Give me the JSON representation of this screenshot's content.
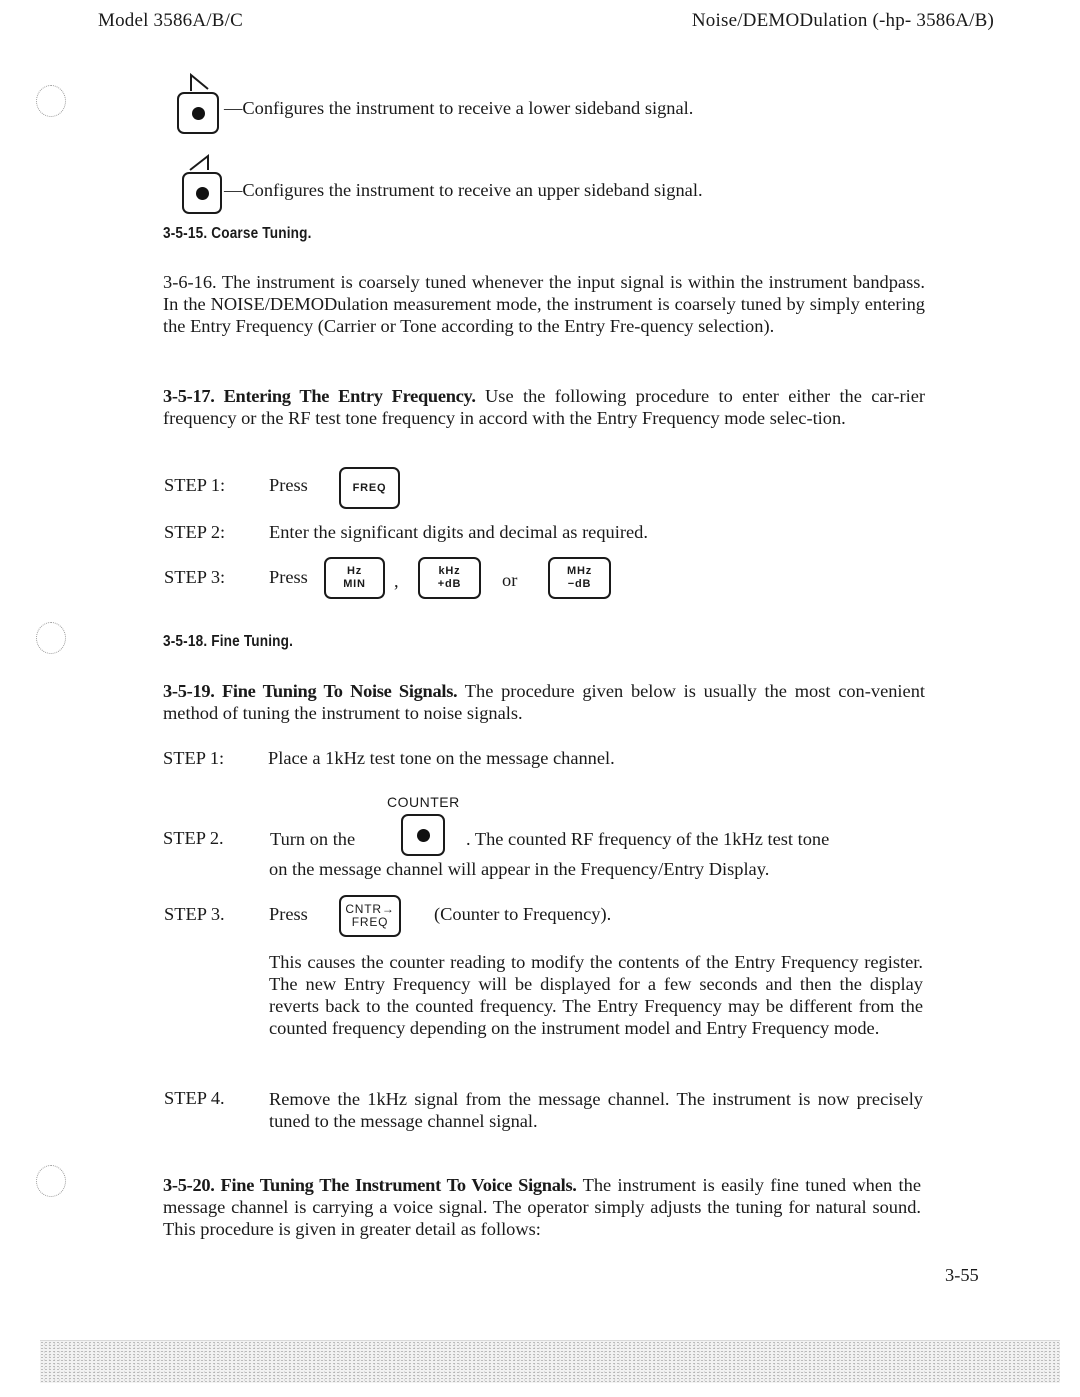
{
  "header": {
    "left": "Model 3586A/B/C",
    "right": "Noise/DEMODulation (-hp- 3586A/B)"
  },
  "sideband": {
    "lower": {
      "icon": "lower-sideband-arrow-icon",
      "text": "—Configures the instrument to receive a lower sideband signal."
    },
    "upper": {
      "icon": "upper-sideband-arrow-icon",
      "text": "—Configures the instrument to receive an upper sideband signal."
    }
  },
  "sections": {
    "coarse_heading": "3-5-15. Coarse Tuning.",
    "coarse_para": "3-6-16. The instrument is coarsely tuned whenever the input signal is within the instrument bandpass. In the NOISE/DEMODulation measurement mode, the instrument is coarsely tuned by simply entering the Entry Frequency (Carrier or Tone according to the Entry Fre-quency selection).",
    "entering_bold": "3-5-17. Entering The Entry Frequency.",
    "entering_text": " Use the following procedure to enter either the car-rier frequency or the RF test tone frequency in accord with the Entry Frequency mode selec-tion.",
    "fine_heading": "3-5-18. Fine Tuning.",
    "fine_noise_bold": "3-5-19. Fine Tuning To Noise Signals.",
    "fine_noise_text": " The procedure given below is usually the most con-venient method of tuning the instrument to noise signals.",
    "voice_bold": "3-5-20. Fine Tuning The Instrument To Voice Signals.",
    "voice_text": " The instrument is easily fine tuned when the message channel is carrying a voice signal. The operator simply adjusts the tuning for natural sound. This procedure is given in greater detail as follows:"
  },
  "entry_steps": {
    "s1_label": "STEP 1:",
    "s1_press": "Press",
    "key_freq": "FREQ",
    "s2_label": "STEP 2:",
    "s2_text": "Enter the significant digits and decimal as required.",
    "s3_label": "STEP 3:",
    "s3_press": "Press",
    "key_hz_top": "Hz",
    "key_hz_bottom": "MIN",
    "comma": ",",
    "key_khz_top": "kHz",
    "key_khz_bottom": "+dB",
    "or": "or",
    "key_mhz_top": "MHz",
    "key_mhz_bottom": "−dB"
  },
  "noise_steps": {
    "s1_label": "STEP 1:",
    "s1_text": "Place a 1kHz test tone on the message channel.",
    "counter_label": "COUNTER",
    "s2_label": "STEP 2.",
    "s2_text_a": "Turn on the",
    "s2_text_b": ". The counted RF frequency of the 1kHz test tone",
    "s2_text_c": "on the message channel will appear in the Frequency/Entry Display.",
    "s3_label": "STEP 3.",
    "s3_press": "Press",
    "key_cntr_top": "CNTR→",
    "key_cntr_bottom": "FREQ",
    "s3_after": "(Counter to Frequency).",
    "s3_para": "This causes the counter reading to modify the contents of the Entry Frequency register. The new Entry Frequency will be displayed for a few seconds and then the display reverts back to the counted frequency. The Entry Frequency may be different from the counted frequency depending on the instrument model and Entry Frequency mode.",
    "s4_label": "STEP 4.",
    "s4_text": "Remove the 1kHz signal from the message channel. The instrument is now precisely tuned to the message channel signal."
  },
  "footer": {
    "page_number": "3-55"
  }
}
